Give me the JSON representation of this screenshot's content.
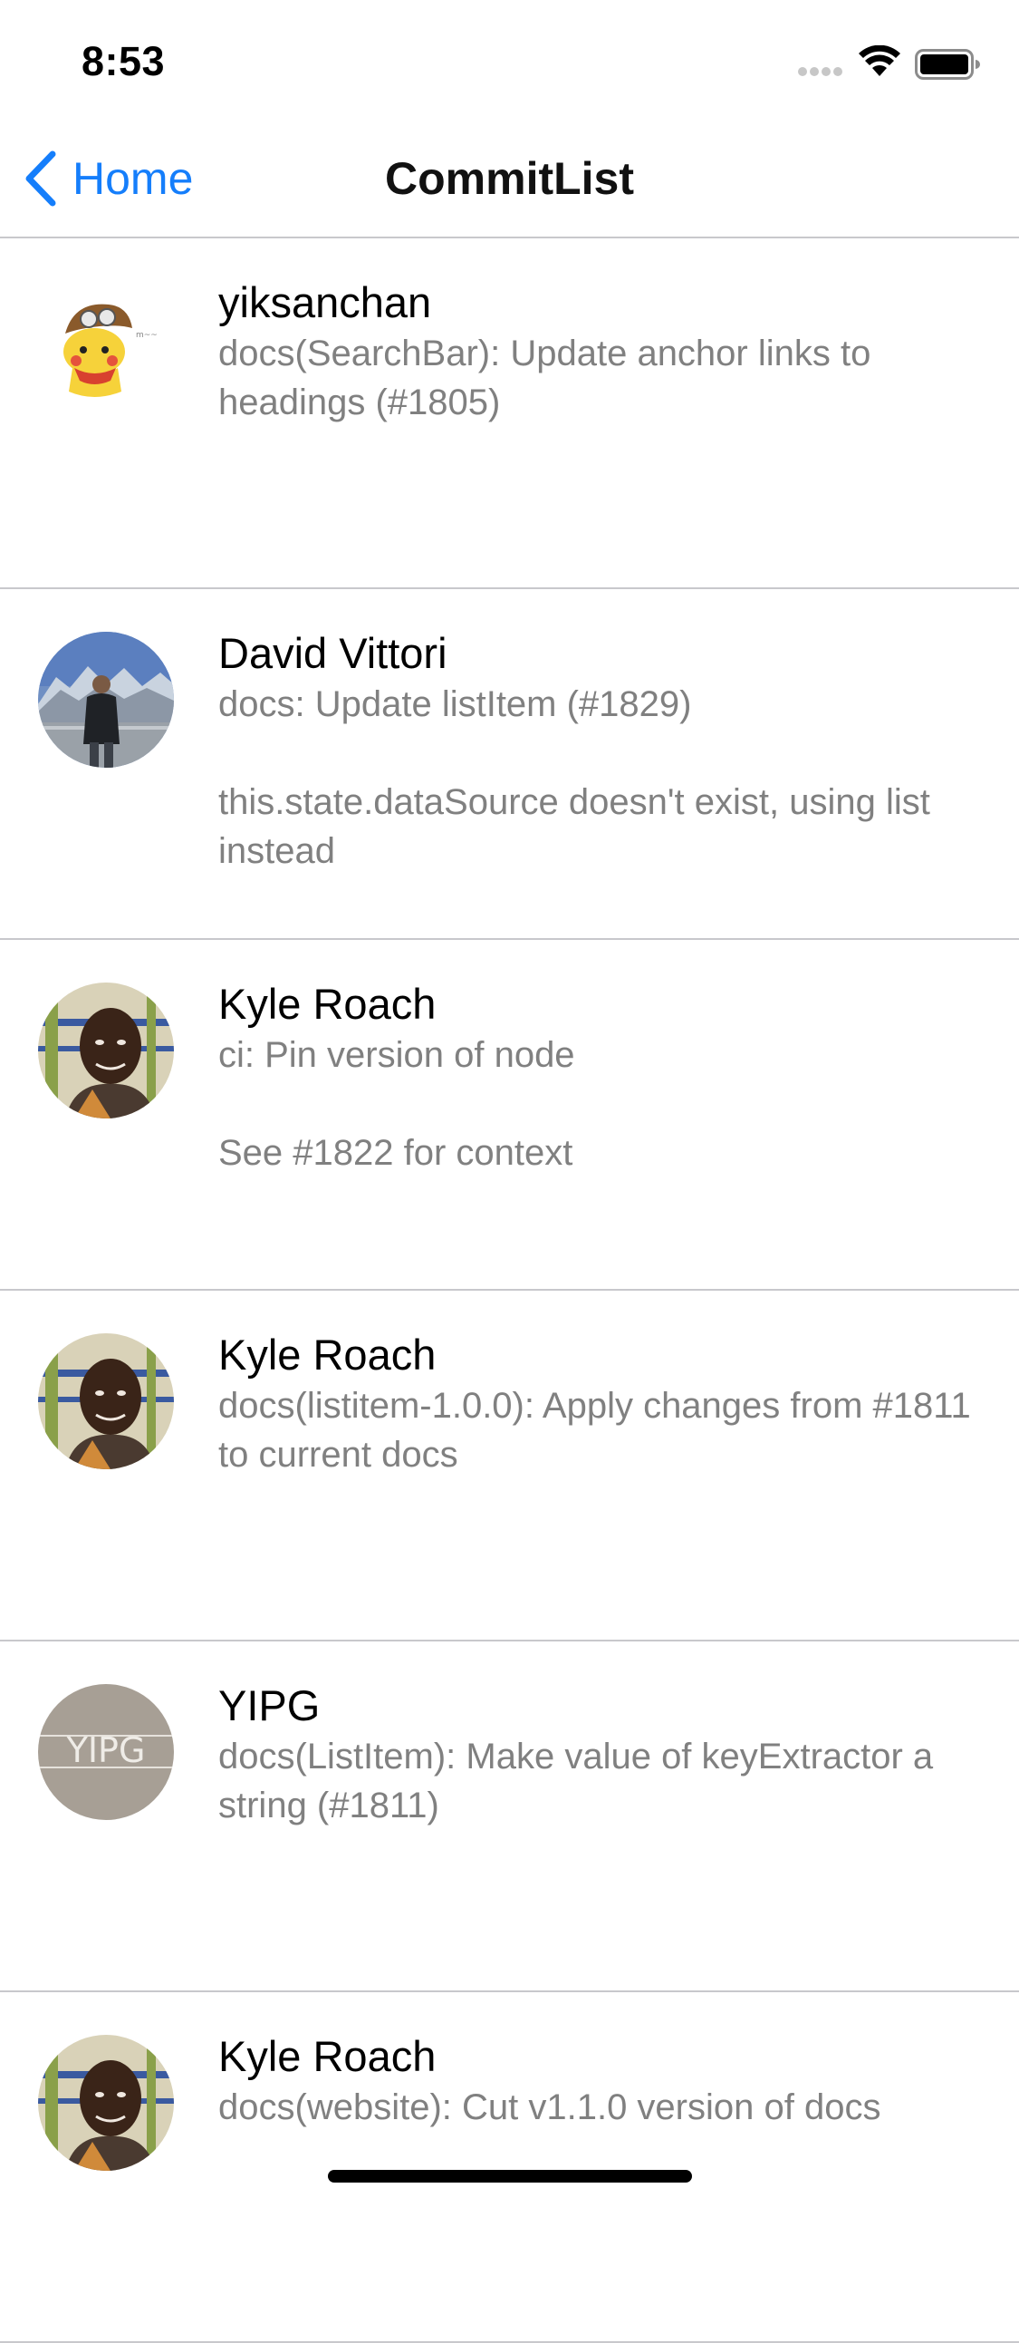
{
  "status_bar": {
    "time": "8:53",
    "icons": [
      "cellular-signal-icon",
      "wifi-icon",
      "battery-icon"
    ]
  },
  "nav": {
    "back_label": "Home",
    "back_icon": "chevron-left-icon",
    "title": "CommitList",
    "accent_color": "#157efb"
  },
  "commits": [
    {
      "author": "yiksanchan",
      "message": "docs(SearchBar): Update anchor links to headings (#1805)",
      "avatar": "pikachu-avatar"
    },
    {
      "author": "David Vittori",
      "message": "docs: Update listItem (#1829)\n\nthis.state.dataSource doesn't exist, using list instead",
      "avatar": "photo-avatar-mountains"
    },
    {
      "author": "Kyle Roach",
      "message": "ci: Pin version of node\n\nSee #1822 for context",
      "avatar": "photo-avatar-kyle"
    },
    {
      "author": "Kyle Roach",
      "message": "docs(listitem-1.0.0): Apply changes from #1811 to current docs",
      "avatar": "photo-avatar-kyle"
    },
    {
      "author": "YIPG",
      "message": "docs(ListItem): Make value of keyExtractor a string (#1811)",
      "avatar": "text-avatar-yipg",
      "avatar_text": "YIPG"
    },
    {
      "author": "Kyle Roach",
      "message": "docs(website): Cut v1.1.0 version of docs",
      "avatar": "photo-avatar-kyle"
    }
  ]
}
